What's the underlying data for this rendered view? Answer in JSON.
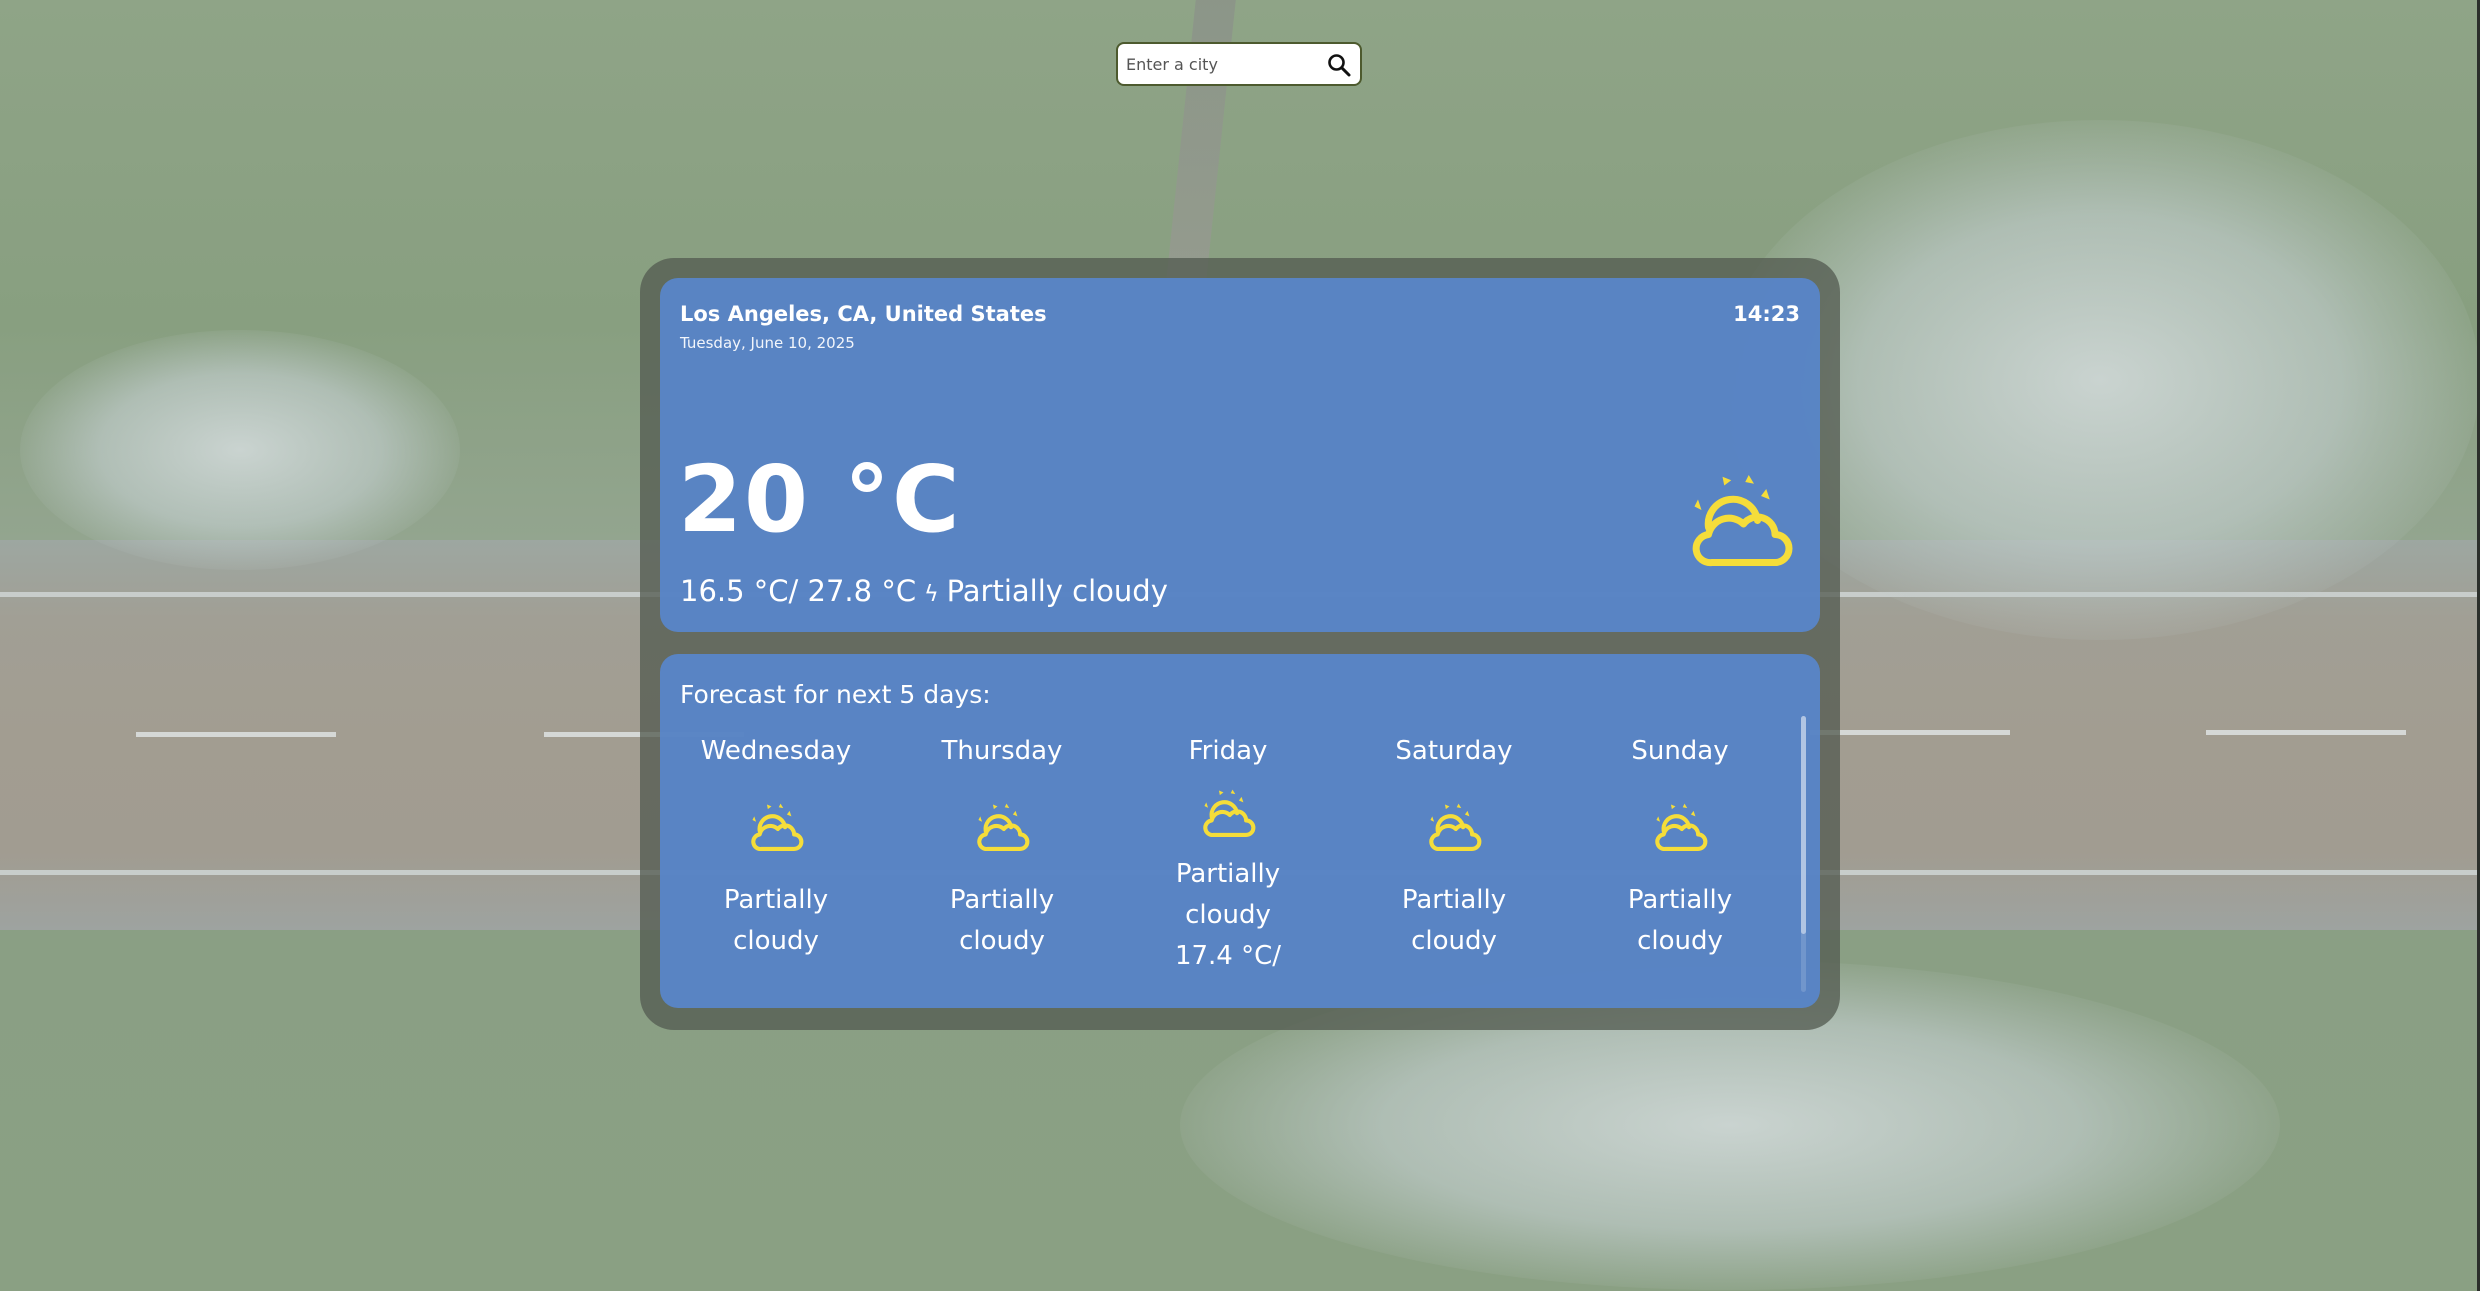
{
  "search": {
    "placeholder": "Enter a city",
    "icon": "search-icon"
  },
  "current": {
    "location": "Los Angeles, CA, United States",
    "date": "Tuesday, June 10, 2025",
    "time": "14:23",
    "temperature": "20 °C",
    "min_max": "16.5 °C/ 27.8 °C",
    "separator": "ϟ",
    "condition": "Partially cloudy",
    "icon": "partly-cloudy-icon",
    "icon_color": "#f5dd3a"
  },
  "forecast": {
    "title": "Forecast for next 5 days:",
    "days": [
      {
        "name": "Wednesday",
        "line1": "Partially",
        "line2": "cloudy",
        "line3": "",
        "icon": "partly-cloudy-icon"
      },
      {
        "name": "Thursday",
        "line1": "Partially",
        "line2": "cloudy",
        "line3": "",
        "icon": "partly-cloudy-icon"
      },
      {
        "name": "Friday",
        "line1": "Partially",
        "line2": "cloudy",
        "line3": "17.4 °C/",
        "icon": "partly-cloudy-icon"
      },
      {
        "name": "Saturday",
        "line1": "Partially",
        "line2": "cloudy",
        "line3": "",
        "icon": "partly-cloudy-icon"
      },
      {
        "name": "Sunday",
        "line1": "Partially",
        "line2": "cloudy",
        "line3": "",
        "icon": "partly-cloudy-icon"
      }
    ]
  },
  "colors": {
    "panel": "#5888d2",
    "accent_icon": "#f5dd3a"
  }
}
